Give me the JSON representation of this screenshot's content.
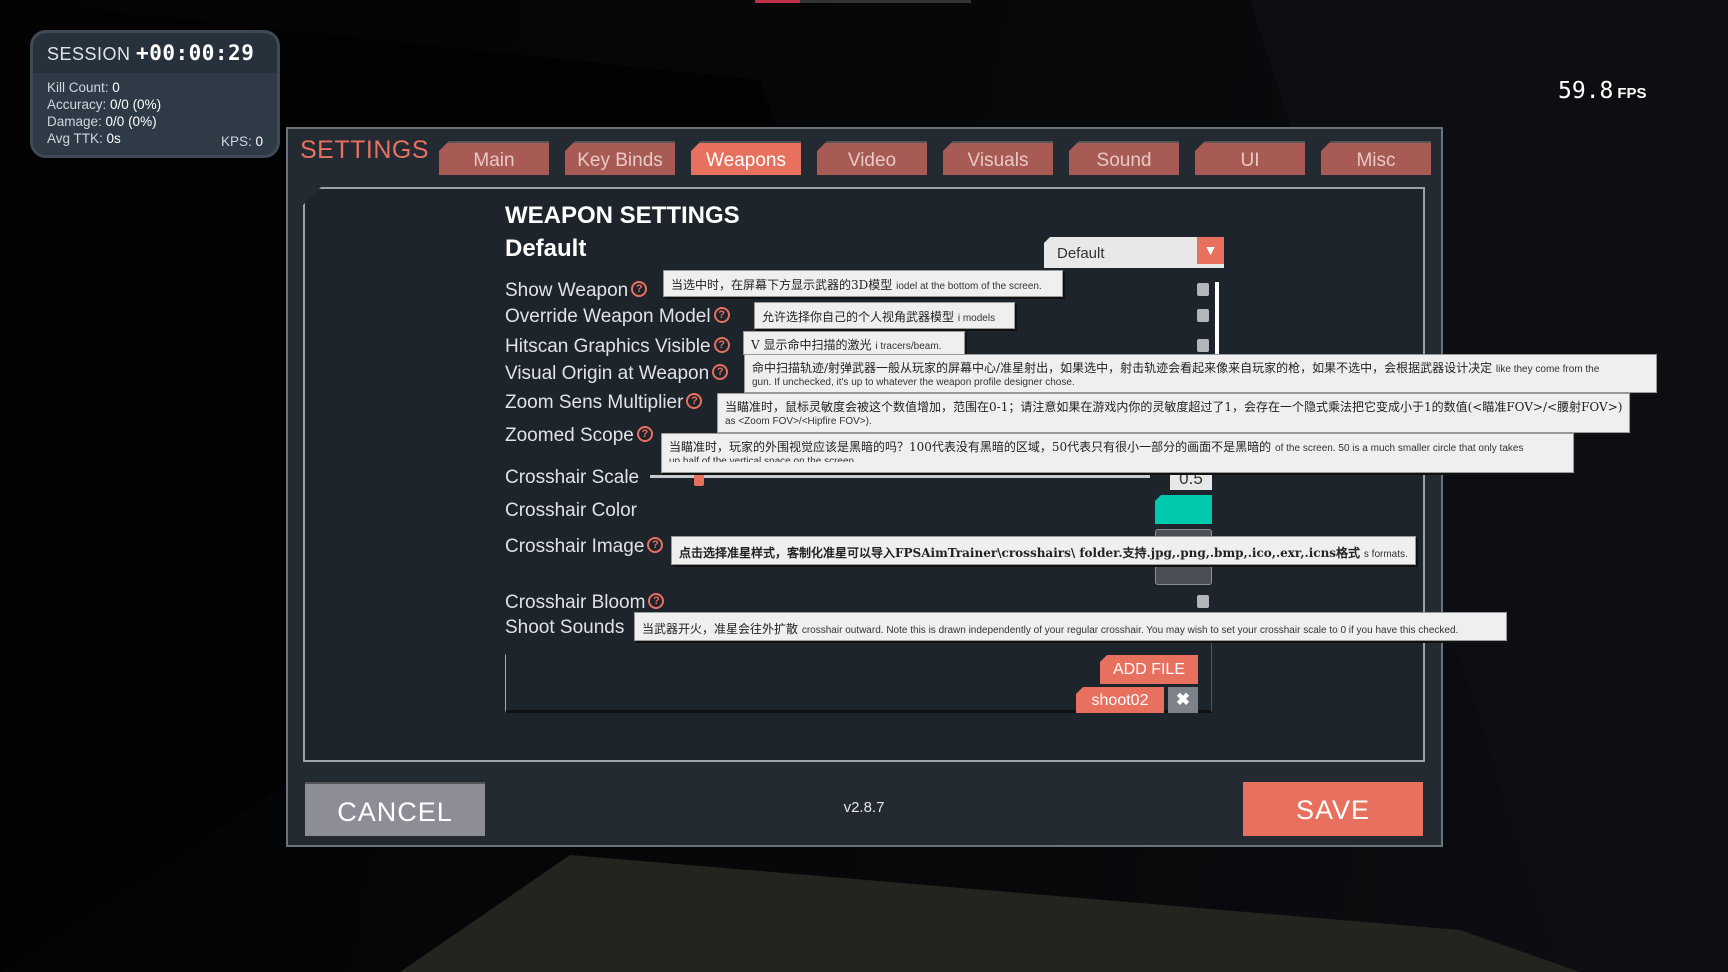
{
  "hud": {
    "session_label": "SESSION",
    "session_time": "+00:00:29",
    "kill_count_label": "Kill Count:",
    "kill_count": "0",
    "accuracy_label": "Accuracy:",
    "accuracy": "0/0 (0%)",
    "damage_label": "Damage:",
    "damage": "0/0 (0%)",
    "avg_ttk_label": "Avg TTK:",
    "avg_ttk": "0s",
    "kps_label": "KPS:",
    "kps": "0",
    "fps_value": "59.8",
    "fps_label": "FPS"
  },
  "settings": {
    "title": "SETTINGS",
    "tabs": [
      {
        "label": "Main",
        "active": false
      },
      {
        "label": "Key Binds",
        "active": false
      },
      {
        "label": "Weapons",
        "active": true
      },
      {
        "label": "Video",
        "active": false
      },
      {
        "label": "Visuals",
        "active": false
      },
      {
        "label": "Sound",
        "active": false
      },
      {
        "label": "UI",
        "active": false
      },
      {
        "label": "Misc",
        "active": false
      }
    ],
    "section_title": "WEAPON SETTINGS",
    "profile_name": "Default",
    "profile_dropdown": {
      "selected": "Default"
    },
    "help_glyph": "?",
    "rows": {
      "show_weapon": {
        "label": "Show Weapon",
        "checked": false
      },
      "override_weapon_model": {
        "label": "Override Weapon Model",
        "checked": false
      },
      "hitscan_graphics_visible": {
        "label": "Hitscan Graphics Visible",
        "checked": false
      },
      "visual_origin_at_weapon": {
        "label": "Visual Origin at Weapon"
      },
      "zoom_sens_multiplier": {
        "label": "Zoom Sens Multiplier"
      },
      "zoomed_scope": {
        "label": "Zoomed Scope"
      },
      "crosshair_scale": {
        "label": "Crosshair Scale",
        "value": "0.5"
      },
      "crosshair_color": {
        "label": "Crosshair Color",
        "color": "#00c9ad"
      },
      "crosshair_image": {
        "label": "Crosshair Image"
      },
      "crosshair_bloom": {
        "label": "Crosshair Bloom",
        "checked": false
      },
      "shoot_sounds": {
        "label": "Shoot Sounds",
        "add_file": "ADD FILE",
        "files": [
          "shoot02"
        ],
        "remove_glyph": "✖"
      }
    },
    "tooltips": {
      "show_weapon": {
        "zh": "当选中时，在屏幕下方显示武器的3D模型",
        "en": "iodel at the bottom of the screen."
      },
      "override_weapon_model": {
        "zh": "允许选择你自己的个人视角武器模型",
        "en": "i models"
      },
      "hitscan_graphics_visible": {
        "zh": "V 显示命中扫描的激光",
        "en": "i tracers/beam."
      },
      "visual_origin_at_weapon": {
        "zh": "命中扫描轨迹/射弹武器一般从玩家的屏幕中心/准星射出，如果选中，射击轨迹会看起来像来自玩家的枪，如果不选中，会根据武器设计决定",
        "en": "like they come from the",
        "en2": "gun.  If unchecked, it's up to whatever the weapon profile designer chose."
      },
      "zoom_sens_multiplier": {
        "zh": "当瞄准时，鼠标灵敏度会被这个数值增加，范围在0-1；请注意如果在游戏内你的灵敏度超过了1，会存在一个隐式乘法把它变成小于1的数值(<瞄准FOV>/<腰射FOV>)",
        "en2": "as <Zoom FOV>/<Hipfire FOV>)."
      },
      "zoomed_scope": {
        "zh": "当瞄准时，玩家的外围视觉应该是黑暗的吗？100代表没有黑暗的区域，50代表只有很小一部分的画面不是黑暗的",
        "en": "of the screen.  50 is a much smaller circle that only takes",
        "en2": "up half of the vertical space on the screen."
      },
      "crosshair_image": {
        "zh": "点击选择准星样式，客制化准星可以导入FPSAimTrainer\\crosshairs\\ folder.支持.jpg,.png,.bmp,.ico,.exr,.icns格式",
        "en": "s formats."
      },
      "crosshair_bloom": {
        "zh": "当武器开火，准星会往外扩散",
        "en": "crosshair outward.  Note this is drawn independently of your regular crosshair.  You may wish to set your crosshair scale to 0 if you have this checked."
      }
    },
    "footer": {
      "cancel": "CANCEL",
      "version": "v2.8.7",
      "save": "SAVE"
    },
    "colors": {
      "accent": "#e8705f",
      "tab_inactive": "#a85a55",
      "panel": "#232a32",
      "cancel": "#8c8d96"
    }
  }
}
